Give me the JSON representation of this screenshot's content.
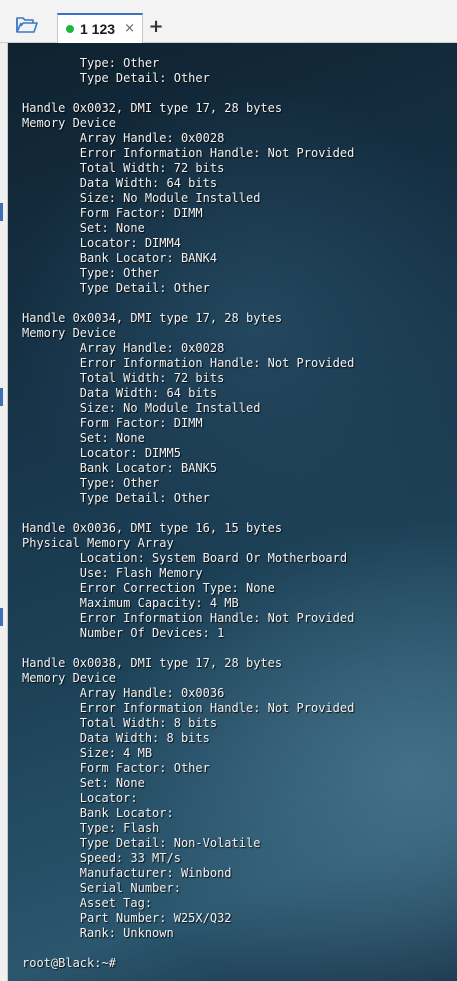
{
  "tabbar": {
    "tab_title": "1 123",
    "close_glyph": "×",
    "add_glyph": "+"
  },
  "terminal": {
    "output": "        Type: Other\n        Type Detail: Other\n\nHandle 0x0032, DMI type 17, 28 bytes\nMemory Device\n        Array Handle: 0x0028\n        Error Information Handle: Not Provided\n        Total Width: 72 bits\n        Data Width: 64 bits\n        Size: No Module Installed\n        Form Factor: DIMM\n        Set: None\n        Locator: DIMM4\n        Bank Locator: BANK4\n        Type: Other\n        Type Detail: Other\n\nHandle 0x0034, DMI type 17, 28 bytes\nMemory Device\n        Array Handle: 0x0028\n        Error Information Handle: Not Provided\n        Total Width: 72 bits\n        Data Width: 64 bits\n        Size: No Module Installed\n        Form Factor: DIMM\n        Set: None\n        Locator: DIMM5\n        Bank Locator: BANK5\n        Type: Other\n        Type Detail: Other\n\nHandle 0x0036, DMI type 16, 15 bytes\nPhysical Memory Array\n        Location: System Board Or Motherboard\n        Use: Flash Memory\n        Error Correction Type: None\n        Maximum Capacity: 4 MB\n        Error Information Handle: Not Provided\n        Number Of Devices: 1\n\nHandle 0x0038, DMI type 17, 28 bytes\nMemory Device\n        Array Handle: 0x0036\n        Error Information Handle: Not Provided\n        Total Width: 8 bits\n        Data Width: 8 bits\n        Size: 4 MB\n        Form Factor: Other\n        Set: None\n        Locator:\n        Bank Locator:\n        Type: Flash\n        Type Detail: Non-Volatile\n        Speed: 33 MT/s\n        Manufacturer: Winbond\n        Serial Number:\n        Asset Tag:\n        Part Number: W25X/Q32\n        Rank: Unknown\n\nroot@Black:~#",
    "status_color": "#1fb83a",
    "accent_color": "#3b73c4"
  },
  "icons": {
    "folder": "folder-icon",
    "status_dot": "connected-dot-icon"
  }
}
